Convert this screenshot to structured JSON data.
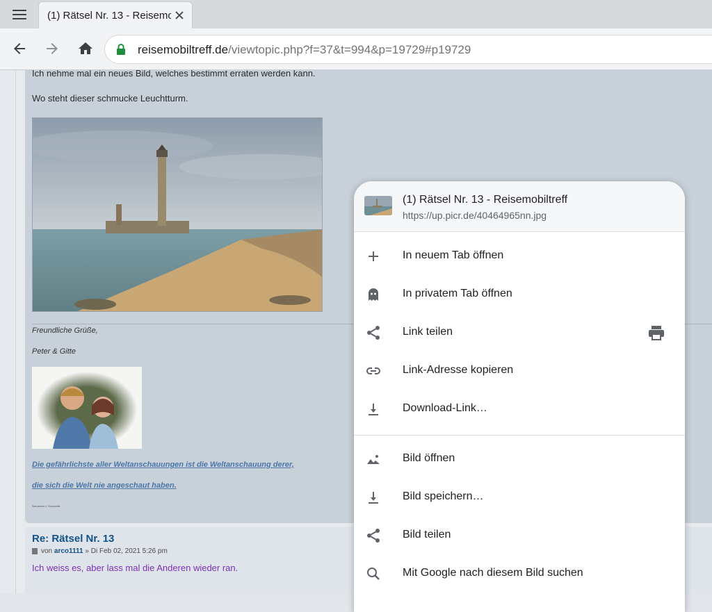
{
  "browser": {
    "tab_title": "(1) Rätsel Nr. 13 - Reisemobiltreff",
    "url_host": "reisemobiltreff.de",
    "url_path": "/viewtopic.php?f=37&t=994&p=19729#p19729"
  },
  "post1": {
    "intro_text": "Ich nehme mal ein neues Bild, welches bestimmt erraten werden kann.",
    "question_text": "Wo steht dieser schmucke Leuchtturm.",
    "signature_greeting": "Freundliche Grüße,",
    "signature_names": "Peter & Gitte",
    "signature_quote_line1": "Die gefährlichste aller Weltanschauungen ist die Weltanschauung derer,",
    "signature_quote_line2": "die sich die Welt nie angeschaut haben.",
    "signature_small": "Alexander v. Humboldt"
  },
  "post2": {
    "title": "Re: Rätsel Nr. 13",
    "meta_prefix": "von",
    "author": "arco1111",
    "meta_date": "» Di Feb 02, 2021 5:26 pm",
    "body": "Ich weiss es, aber lass mal die Anderen wieder ran."
  },
  "context_menu": {
    "header_title": "(1) Rätsel Nr. 13 - Reisemobiltreff",
    "header_url": "https://up.picr.de/40464965nn.jpg",
    "items": [
      {
        "label": "In neuem Tab öffnen",
        "icon": "plus-icon"
      },
      {
        "label": "In privatem Tab öffnen",
        "icon": "ghost-icon"
      },
      {
        "label": "Link teilen",
        "icon": "share-icon"
      },
      {
        "label": "Link-Adresse kopieren",
        "icon": "link-icon"
      },
      {
        "label": "Download-Link…",
        "icon": "download-icon"
      },
      {
        "label": "Bild öffnen",
        "icon": "image-icon"
      },
      {
        "label": "Bild speichern…",
        "icon": "download-icon"
      },
      {
        "label": "Bild teilen",
        "icon": "share-icon"
      },
      {
        "label": "Mit Google nach diesem Bild suchen",
        "icon": "search-icon"
      }
    ]
  },
  "colors": {
    "accent_link": "#105289",
    "lock_green": "#1e8e3e",
    "post_bg": "#c8d0d9"
  }
}
